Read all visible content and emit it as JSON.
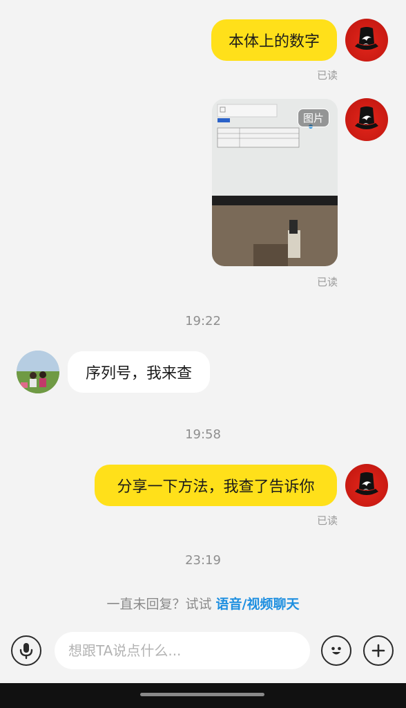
{
  "messages": {
    "m1": {
      "text": "本体上的数字",
      "status": "已读"
    },
    "m2": {
      "image_tag": "图片",
      "status": "已读"
    },
    "t1": "19:22",
    "m3": {
      "text": "序列号，我来查"
    },
    "t2": "19:58",
    "m4": {
      "text": "分享一下方法，我查了告诉你",
      "status": "已读"
    },
    "t3": "23:19"
  },
  "hint": {
    "prefix": "一直未回复？试试 ",
    "link": "语音/视频聊天"
  },
  "input_bar": {
    "placeholder": "想跟TA说点什么...",
    "left_icon": "microphone-icon",
    "right_icons": [
      "emoji-icon",
      "plus-icon"
    ]
  },
  "colors": {
    "my_bubble": "#ffe01a",
    "other_bubble": "#ffffff",
    "background": "#f3f3f3",
    "link": "#1e8fe0"
  }
}
